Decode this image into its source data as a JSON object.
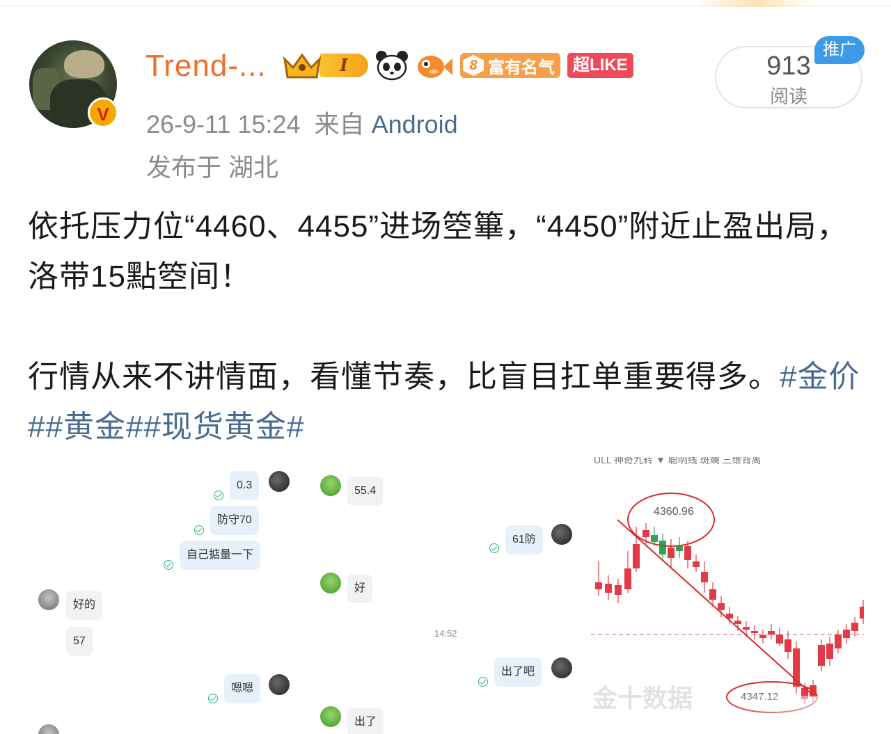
{
  "post": {
    "username": "Trend-...",
    "level": "I",
    "fame_level": "8",
    "fame_label": "富有名气",
    "chao_like": "超LIKE",
    "time": "26-9-11 15:24",
    "from_prefix": "来自",
    "source": "Android",
    "location": "发布于 湖北",
    "read_count": "913",
    "read_label": "阅读",
    "promo": "推广",
    "line1": "依托压力位“4460、4455”进场箜篳，“4450”附近止盈出局，洛带15點箜间！",
    "line2_text": "行情从来不讲情面，看懂节奏，比盲目扛单重要得多。",
    "tags": [
      "#金价#",
      "#黄金#",
      "#现货黄金#"
    ]
  },
  "chat": {
    "messages": [
      {
        "text": "0.3",
        "side": "right"
      },
      {
        "text": "防守70",
        "side": "right"
      },
      {
        "text": "自己掂量一下",
        "side": "right"
      },
      {
        "text": "好的",
        "side": "left"
      },
      {
        "text": "57",
        "side": "left"
      },
      {
        "text": "嗯嗯",
        "side": "right"
      },
      {
        "text": "55.4",
        "side": "left"
      },
      {
        "text": "好",
        "side": "left"
      },
      {
        "text": "出了",
        "side": "left"
      },
      {
        "text": "61防",
        "side": "right"
      },
      {
        "text": "出了吧",
        "side": "right"
      }
    ],
    "time": "14:52"
  },
  "kchart": {
    "header": "ULL  神奇九转  ▼ 聪明线  斑斓  三维背离",
    "high_label": "4360.96",
    "low_label": "4347.12",
    "watermark": "金十数据",
    "colors": {
      "up": "#e23b48",
      "down": "#2fa35a",
      "annotation": "#d92a2a"
    }
  }
}
